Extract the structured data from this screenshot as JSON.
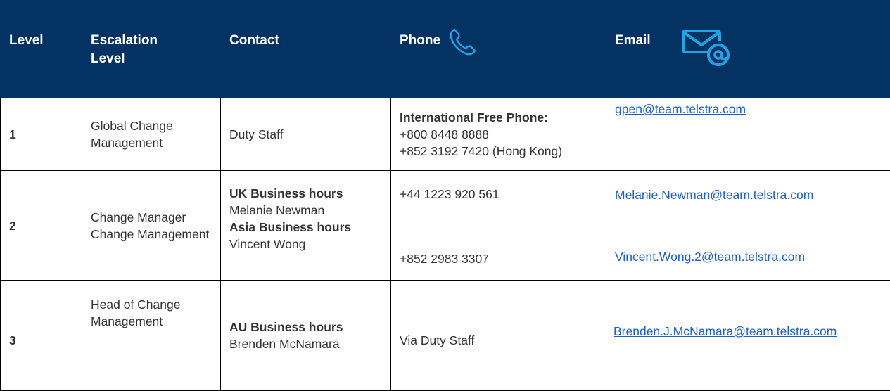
{
  "header": {
    "level": "Level",
    "escalation_level": "Escalation Level",
    "contact": "Contact",
    "phone": "Phone",
    "email": "Email",
    "phone_icon": "phone-icon",
    "email_icon": "email-at-icon",
    "header_bg": "#043262",
    "icon_color": "#1fa5e6"
  },
  "rows": [
    {
      "level": "1",
      "escalation": "Global Change Management",
      "contact": "Duty Staff",
      "phone_heading": "International Free Phone:",
      "phone_line1": "+800 8448 8888",
      "phone_line2": "+852 3192 7420 (Hong Kong)",
      "email": "gpen@team.telstra.com"
    },
    {
      "level": "2",
      "escalation": "Change Manager Change Management",
      "contact_heading1": "UK Business hours",
      "contact_name1": "Melanie Newman",
      "contact_heading2": "Asia Business hours",
      "contact_name2": "Vincent Wong",
      "phone1": "+44 1223 920 561",
      "phone2": "+852 2983 3307",
      "email1": "Melanie.Newman@team.telstra.com",
      "email2": "Vincent.Wong.2@team.telstra.com"
    },
    {
      "level": "3",
      "escalation": "Head of Change Management",
      "contact_heading": "AU Business hours",
      "contact_name": "Brenden McNamara",
      "phone": "Via Duty Staff",
      "email": "Brenden.J.McNamara@team.telstra.com"
    }
  ],
  "link_color": "#1a5fd0"
}
